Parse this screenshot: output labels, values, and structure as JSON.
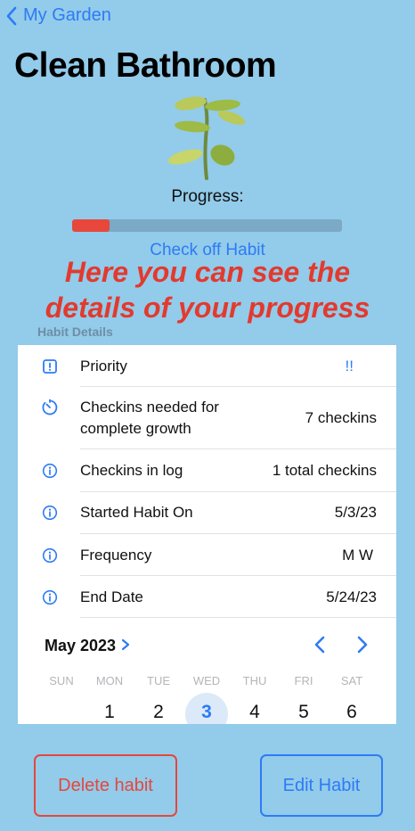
{
  "nav": {
    "back_label": "My Garden"
  },
  "page": {
    "title": "Clean Bathroom"
  },
  "progress": {
    "label": "Progress:",
    "fraction": 0.14
  },
  "actions": {
    "check_off_label": "Check off Habit",
    "delete_label": "Delete habit",
    "edit_label": "Edit Habit"
  },
  "overlay": {
    "line1": "Here you can see the",
    "line2": "details of your progress"
  },
  "details": {
    "header": "Habit Details",
    "rows": [
      {
        "icon": "exclamation-square-icon",
        "label": "Priority",
        "value": "!!"
      },
      {
        "icon": "timer-icon",
        "label": "Checkins needed for complete growth",
        "value": "7 checkins"
      },
      {
        "icon": "info-icon",
        "label": "Checkins in log",
        "value": "1 total checkins"
      },
      {
        "icon": "info-icon",
        "label": "Started Habit On",
        "value": "5/3/23"
      },
      {
        "icon": "info-icon",
        "label": "Frequency",
        "value": "M W"
      },
      {
        "icon": "info-icon",
        "label": "End Date",
        "value": "5/24/23"
      }
    ]
  },
  "calendar": {
    "month_label": "May 2023",
    "weekdays": [
      "SUN",
      "MON",
      "TUE",
      "WED",
      "THU",
      "FRI",
      "SAT"
    ],
    "days": [
      "",
      "1",
      "2",
      "3",
      "4",
      "5",
      "6"
    ],
    "selected_day": "3"
  },
  "colors": {
    "background": "#93CBEA",
    "accent": "#2D7BF5",
    "danger": "#E5473C",
    "overlay_text": "#E23A2E"
  }
}
